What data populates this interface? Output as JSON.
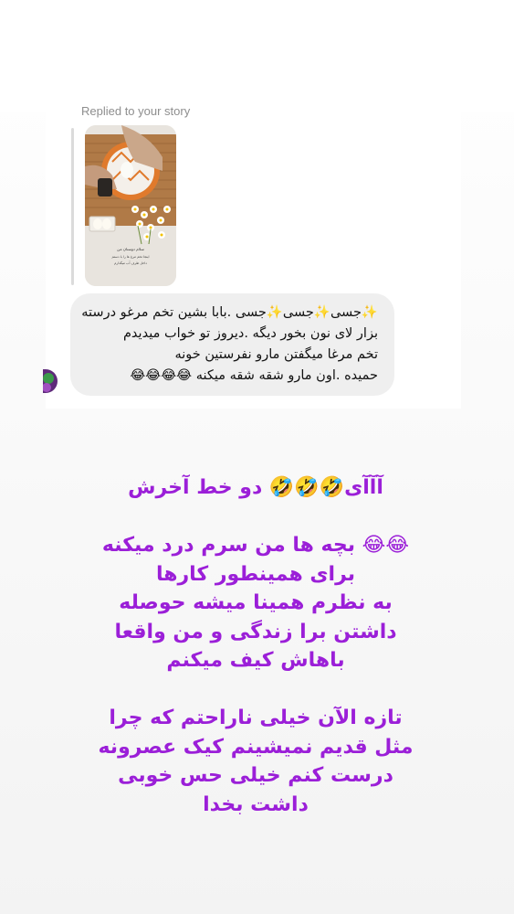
{
  "reply_header": "Replied to your story",
  "story_thumbnail": {
    "icon": "story-image",
    "caption_lines": [
      "سلام دوستان من",
      "اینجا تخم مرغ ها را با دستم",
      "داخل ظرف آب میگذارم"
    ]
  },
  "message": {
    "text": "✨جسی✨جسی✨جسی .بابا بشین تخم مرغو درسته\nبزار لای نون بخور دیگه .دیروز تو خواب میدیدم\nتخم مرغا میگفتن مارو نفرستین خونه\nحمیده .اون مارو شقه شقه میکنه 😂😂😂😂"
  },
  "sender_avatar": {
    "icon": "avatar"
  },
  "story_caption": {
    "text": "آآآی🤣🤣🤣 دو خط آخرش\n\n😂😂 بچه ها من سرم درد میکنه\nبرای همینطور کارها\nبه نظرم همینا میشه حوصله\nداشتن برا زندگی و من واقعا\nباهاش کیف میکنم\n\nتازه الآن خیلی ناراحتم که چرا\nمثل قدیم نمیشینم کیک عصرونه\nدرست کنم خیلی حس خوبی\nداشت بخدا"
  },
  "colors": {
    "caption": "#9b1fd8",
    "bubble": "#efefef",
    "reply_bar": "#dbdbdb",
    "header_text": "#8e8e8e"
  }
}
